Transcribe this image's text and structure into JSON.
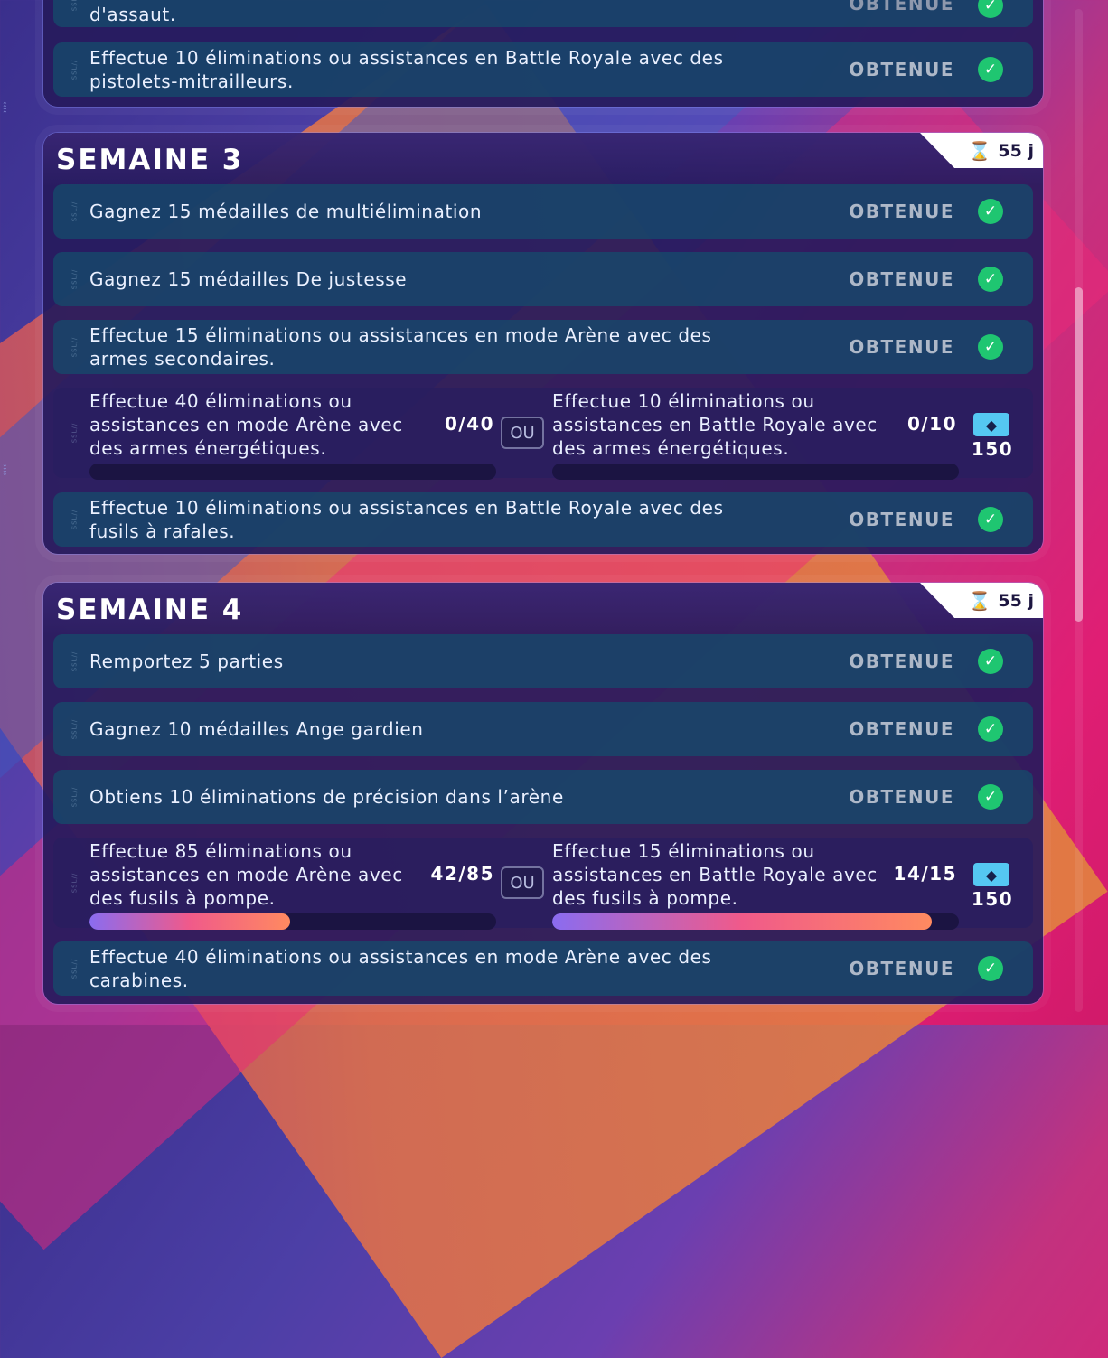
{
  "colors": {
    "accent": "#1fc671",
    "reward": "#55c8f2",
    "panel": "#261a5c"
  },
  "top_panel": {
    "rows": [
      {
        "label": "d'assaut.",
        "status": "OBTENUE"
      },
      {
        "label": "Effectue 10 éliminations ou assistances en Battle Royale avec des pistolets-mitrailleurs.",
        "status": "OBTENUE"
      }
    ]
  },
  "weeks": [
    {
      "title": "SEMAINE 3",
      "timer": "55 j",
      "rows": [
        {
          "label": "Gagnez 15 médailles de multiélimination",
          "status": "OBTENUE"
        },
        {
          "label": "Gagnez 15 médailles De justesse",
          "status": "OBTENUE"
        },
        {
          "label": "Effectue 15 éliminations ou assistances en mode Arène avec des armes secondaires.",
          "status": "OBTENUE"
        }
      ],
      "choice": {
        "a": {
          "label": "Effectue 40 éliminations ou assistances en mode Arène avec des armes énergétiques.",
          "count": "0/40",
          "progress": 0
        },
        "or": "OU",
        "b": {
          "label": "Effectue 10 éliminations ou assistances en Battle Royale avec des armes énergétiques.",
          "count": "0/10",
          "progress": 0
        },
        "reward": "150"
      },
      "last": {
        "label": "Effectue 10 éliminations ou assistances en Battle Royale avec des fusils à rafales.",
        "status": "OBTENUE"
      }
    },
    {
      "title": "SEMAINE 4",
      "timer": "55 j",
      "rows": [
        {
          "label": "Remportez 5 parties",
          "status": "OBTENUE"
        },
        {
          "label": "Gagnez 10 médailles Ange gardien",
          "status": "OBTENUE"
        },
        {
          "label": "Obtiens 10 éliminations de précision dans l’arène",
          "status": "OBTENUE"
        }
      ],
      "choice": {
        "a": {
          "label": "Effectue 85 éliminations ou assistances en mode Arène avec des fusils à pompe.",
          "count": "42/85",
          "progress": 0.494
        },
        "or": "OU",
        "b": {
          "label": "Effectue 15 éliminations ou assistances en Battle Royale avec des fusils à pompe.",
          "count": "14/15",
          "progress": 0.933
        },
        "reward": "150"
      },
      "last": {
        "label": "Effectue 40 éliminations ou assistances en mode Arène avec des carabines.",
        "status": "OBTENUE"
      }
    }
  ]
}
